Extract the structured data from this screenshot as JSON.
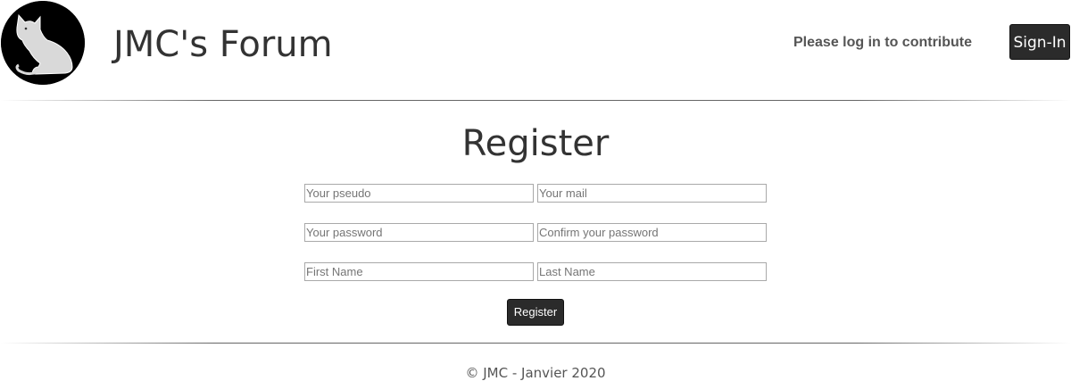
{
  "header": {
    "logo_icon": "cat-logo-icon",
    "site_title": "JMC's Forum",
    "login_hint": "Please log in to contribute",
    "signin_label": "Sign-In"
  },
  "register": {
    "title": "Register",
    "fields": {
      "pseudo_placeholder": "Your pseudo",
      "mail_placeholder": "Your mail",
      "password_placeholder": "Your password",
      "confirm_password_placeholder": "Confirm your password",
      "first_name_placeholder": "First Name",
      "last_name_placeholder": "Last Name"
    },
    "submit_label": "Register"
  },
  "footer": {
    "copyright": "© JMC - Janvier 2020"
  },
  "colors": {
    "button_bg": "#2b2b2b",
    "text": "#333333",
    "muted_text": "#555555"
  }
}
